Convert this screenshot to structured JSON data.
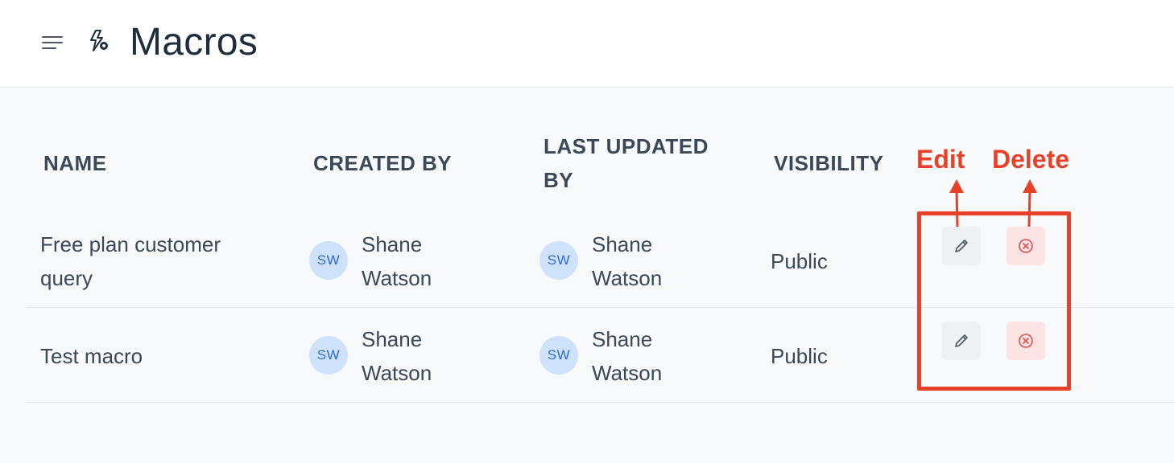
{
  "header": {
    "title": "Macros",
    "menu_icon": "hamburger-menu-icon",
    "page_icon": "macro-bolt-gear-icon"
  },
  "table": {
    "columns": {
      "name": "NAME",
      "created_by": "CREATED BY",
      "last_updated_by_line1": "LAST UPDATED",
      "last_updated_by_line2": "BY",
      "visibility": "VISIBILITY"
    },
    "rows": [
      {
        "name_line1": "Free plan customer",
        "name_line2": "query",
        "created_by": {
          "initials": "SW",
          "first": "Shane",
          "last": "Watson"
        },
        "last_updated_by": {
          "initials": "SW",
          "first": "Shane",
          "last": "Watson"
        },
        "visibility": "Public"
      },
      {
        "name_line1": "Test macro",
        "created_by": {
          "initials": "SW",
          "first": "Shane",
          "last": "Watson"
        },
        "last_updated_by": {
          "initials": "SW",
          "first": "Shane",
          "last": "Watson"
        },
        "visibility": "Public"
      }
    ]
  },
  "annotations": {
    "edit_label": "Edit",
    "delete_label": "Delete",
    "highlight_color": "#e8412a"
  },
  "colors": {
    "avatar_bg": "#cfe2fb",
    "avatar_text": "#2f6bd6",
    "delete_bg": "#fde4e4",
    "delete_icon": "#e04b4b",
    "edit_bg": "#eef1f4"
  }
}
